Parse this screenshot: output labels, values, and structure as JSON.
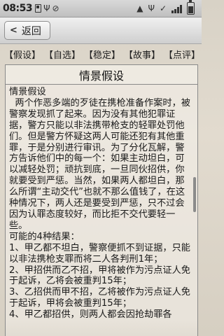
{
  "status_bar": {
    "time": "08:53",
    "icons": [
      "sim-card-icon",
      "usb-icon",
      "do-not-disturb-icon",
      "warning-icon",
      "usb-connected-icon",
      "check-icon",
      "signal-bars-icon",
      "battery-icon"
    ]
  },
  "title_bar": {
    "back_label": "返回"
  },
  "tabs": [
    "【假设】",
    "【自选】",
    "【稳定】",
    "【故事】",
    "【点评】"
  ],
  "panel": {
    "title": "情景假设",
    "paragraphs": [
      "情景假设",
      "  两个作恶多端的歹徒在携枪准备作案时，被警察发现抓了起来。因为没有其他犯罪证据，警方只能以非法携带枪支的轻罪处罚他们。但是警方怀疑这两人可能还犯有其他重罪，于是分别进行审讯。为了分化瓦解，警方告诉他们中的每一个：如果主动坦白，可以减轻处罚；顽抗到底，一旦同伙招供，你就要受到严惩。当然，如果两人都坦白，那么所谓“主动交代”也就不那么值钱了，在这种情况下，两人还是要受到严惩，只不过会因为认罪态度较好，而比拒不交代要轻一些。",
      "可能的4种结果：",
      "1、甲乙都不坦白，警察便抓不到证据，只能以非法携枪支罪而将二人各判刑1年；",
      "2、甲招供而乙不招，甲将被作为污点证人免于起诉，乙将会被重判15年；",
      "3、乙招供而甲不招，乙将被作为污点证人免于起诉，甲将会被重判15年；",
      "4、甲乙都招供，则两人都会因抢劫罪各"
    ]
  }
}
